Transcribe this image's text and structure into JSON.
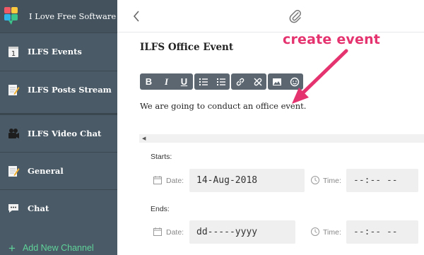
{
  "app": {
    "title": "I Love Free Software"
  },
  "sidebar": {
    "items": [
      {
        "label": "ILFS Events",
        "icon": "calendar-one-icon"
      },
      {
        "label": "ILFS Posts Stream",
        "icon": "notepad-pencil-icon"
      },
      {
        "label": "ILFS Video Chat",
        "icon": "video-chat-icon"
      },
      {
        "label": "General",
        "icon": "notepad-pencil-icon"
      },
      {
        "label": "Chat",
        "icon": "speech-bubble-icon"
      }
    ],
    "add_channel": "Add New Channel"
  },
  "topbar": {
    "back_icon": "chevron-left-icon",
    "attach_icon": "paperclip-icon"
  },
  "post": {
    "title": "ILFS Office Event",
    "body": "We are going to conduct an office event."
  },
  "toolbar": {
    "bold": "B",
    "italic": "I",
    "underline": "U"
  },
  "annotation": {
    "text": "create event",
    "color": "#e4336f"
  },
  "event": {
    "starts_label": "Starts:",
    "ends_label": "Ends:",
    "start_date_label": "Date:",
    "start_date_value": "14-Aug-2018",
    "start_time_label": "Time:",
    "start_time_value": "--:-- --",
    "end_date_label": "Date:",
    "end_date_value": "dd-----yyyy",
    "end_time_label": "Time:",
    "end_time_value": "--:-- --"
  },
  "colors": {
    "sidebar_bg": "#4a5a66",
    "accent_green": "#5fd39a",
    "toolbar_bg": "#5b6670"
  }
}
